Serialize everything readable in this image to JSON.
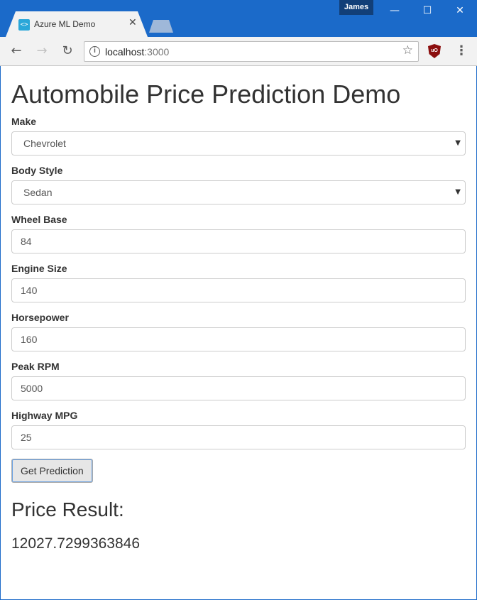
{
  "browser": {
    "profile_name": "James",
    "tab_title": "Azure ML Demo",
    "url_host": "localhost",
    "url_port": ":3000",
    "accent_color": "#1b6ac9"
  },
  "page": {
    "title": "Automobile Price Prediction Demo",
    "fields": [
      {
        "label": "Make",
        "value": "Chevrolet",
        "type": "select"
      },
      {
        "label": "Body Style",
        "value": "Sedan",
        "type": "select"
      },
      {
        "label": "Wheel Base",
        "value": "84",
        "type": "input"
      },
      {
        "label": "Engine Size",
        "value": "140",
        "type": "input"
      },
      {
        "label": "Horsepower",
        "value": "160",
        "type": "input"
      },
      {
        "label": "Peak RPM",
        "value": "5000",
        "type": "input"
      },
      {
        "label": "Highway MPG",
        "value": "25",
        "type": "input"
      }
    ],
    "button_label": "Get Prediction",
    "result_heading": "Price Result:",
    "result_value": "12027.7299363846"
  }
}
